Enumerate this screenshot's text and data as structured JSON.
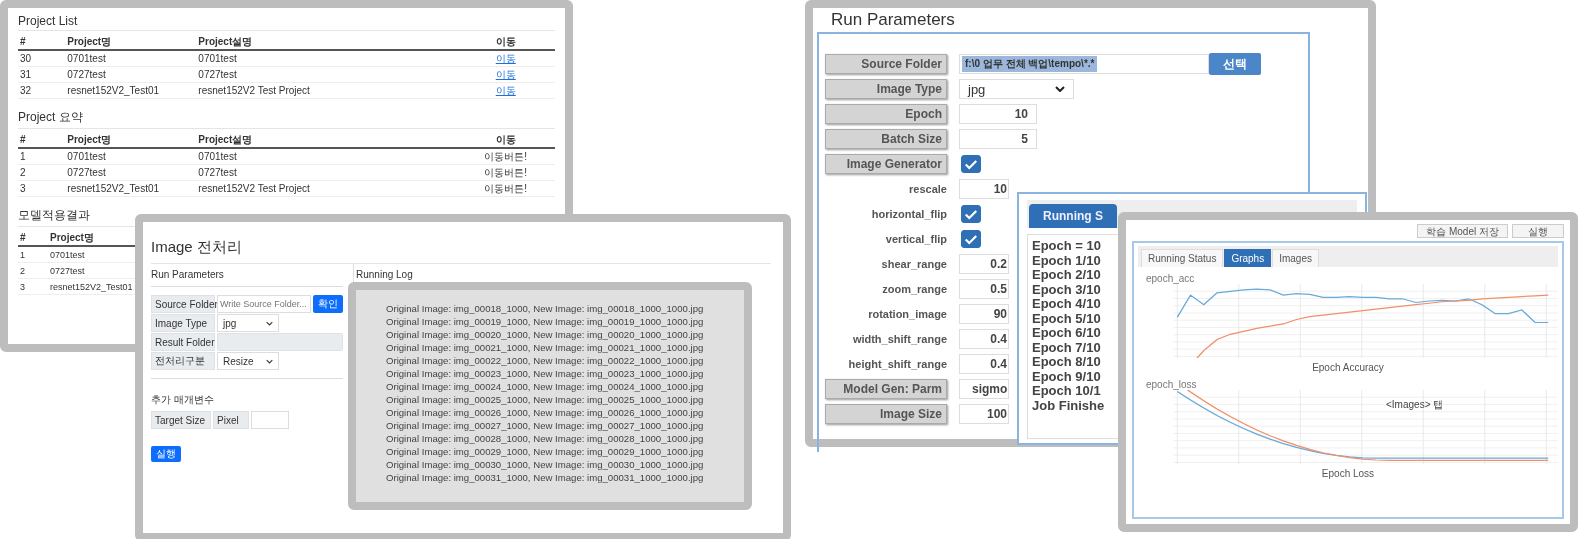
{
  "project_window": {
    "sections": [
      {
        "title": "Project List",
        "columns": [
          "#",
          "Project명",
          "Project설명",
          "이동"
        ],
        "kind": "link",
        "rows": [
          {
            "cells": [
              "30",
              "0701test",
              "0701test"
            ],
            "action": "이동"
          },
          {
            "cells": [
              "31",
              "0727test",
              "0727test"
            ],
            "action": "이동"
          },
          {
            "cells": [
              "32",
              "resnet152V2_Test01",
              "resnet152V2 Test Project"
            ],
            "action": "이동"
          }
        ]
      },
      {
        "title": "Project 요약",
        "columns": [
          "#",
          "Project명",
          "Project설명",
          "이동"
        ],
        "kind": "text",
        "rows": [
          {
            "cells": [
              "1",
              "0701test",
              "0701test"
            ],
            "action": "이동버튼!"
          },
          {
            "cells": [
              "2",
              "0727test",
              "0727test"
            ],
            "action": "이동버튼!"
          },
          {
            "cells": [
              "3",
              "resnet152V2_Test01",
              "resnet152V2 Test Project"
            ],
            "action": "이동버튼!"
          }
        ]
      },
      {
        "title": "모델적용결과",
        "columns": [
          "#",
          "Project명"
        ],
        "rows": [
          {
            "cells": [
              "1",
              "0701test"
            ]
          },
          {
            "cells": [
              "2",
              "0727test"
            ]
          },
          {
            "cells": [
              "3",
              "resnet152V2_Test01"
            ]
          }
        ]
      }
    ]
  },
  "preprocess_window": {
    "title": "Image 전처리",
    "left_heading": "Run Parameters",
    "right_heading": "Running Log",
    "fields": [
      {
        "label": "Source Folder",
        "kind": "text",
        "placeholder": "Write Source Folder...",
        "button": "확인"
      },
      {
        "label": "Image Type",
        "kind": "select",
        "value": "jpg"
      },
      {
        "label": "Result Folder",
        "kind": "disabled"
      },
      {
        "label": "전처리구분",
        "kind": "select",
        "value": "Resize"
      }
    ],
    "extra_heading": "추가 매개변수",
    "extra": {
      "label": "Target Size",
      "unit": "Pixel"
    },
    "run_button": "실행"
  },
  "log_window": {
    "lines": [
      "Original Image: img_00018_1000, New Image: img_00018_1000_1000.jpg",
      "Original Image: img_00019_1000, New Image: img_00019_1000_1000.jpg",
      "Original Image: img_00020_1000, New Image: img_00020_1000_1000.jpg",
      "Original Image: img_00021_1000, New Image: img_00021_1000_1000.jpg",
      "Original Image: img_00022_1000, New Image: img_00022_1000_1000.jpg",
      "Original Image: img_00023_1000, New Image: img_00023_1000_1000.jpg",
      "Original Image: img_00024_1000, New Image: img_00024_1000_1000.jpg",
      "Original Image: img_00025_1000, New Image: img_00025_1000_1000.jpg",
      "Original Image: img_00026_1000, New Image: img_00026_1000_1000.jpg",
      "Original Image: img_00027_1000, New Image: img_00027_1000_1000.jpg",
      "Original Image: img_00028_1000, New Image: img_00028_1000_1000.jpg",
      "Original Image: img_00029_1000, New Image: img_00029_1000_1000.jpg",
      "Original Image: img_00030_1000, New Image: img_00030_1000_1000.jpg",
      "Original Image: img_00031_1000, New Image: img_00031_1000_1000.jpg"
    ]
  },
  "training_window": {
    "title": "Run Parameters",
    "parameters": [
      {
        "label": {
          "text": "Source Folder",
          "kind": "button"
        },
        "kind": "folder",
        "value": "f:\\0 업무 전체 백업\\tempo\\*.*",
        "button": "선택"
      },
      {
        "label": {
          "text": "Image Type",
          "kind": "button"
        },
        "kind": "select",
        "value": "jpg"
      },
      {
        "label": {
          "text": "Epoch",
          "kind": "button"
        },
        "kind": "number",
        "value": "10"
      },
      {
        "label": {
          "text": "Batch Size",
          "kind": "button"
        },
        "kind": "number",
        "value": "5"
      },
      {
        "label": {
          "text": "Image Generator",
          "kind": "button"
        },
        "kind": "check",
        "checked": true
      }
    ],
    "more_parameters": [
      {
        "label": {
          "text": "rescale",
          "kind": "plain"
        },
        "kind": "number",
        "value": "10"
      },
      {
        "label": {
          "text": "horizontal_flip",
          "kind": "plain"
        },
        "kind": "check",
        "checked": true
      },
      {
        "label": {
          "text": "vertical_flip",
          "kind": "plain"
        },
        "kind": "check",
        "checked": true
      },
      {
        "label": {
          "text": "shear_range",
          "kind": "plain"
        },
        "kind": "number",
        "value": "0.2"
      },
      {
        "label": {
          "text": "zoom_range",
          "kind": "plain"
        },
        "kind": "number",
        "value": "0.5"
      },
      {
        "label": {
          "text": "rotation_image",
          "kind": "plain"
        },
        "kind": "number",
        "value": "90"
      },
      {
        "label": {
          "text": "width_shift_range",
          "kind": "plain"
        },
        "kind": "number",
        "value": "0.4"
      },
      {
        "label": {
          "text": "height_shift_range",
          "kind": "plain"
        },
        "kind": "number",
        "value": "0.4"
      },
      {
        "label": {
          "text": "Model Gen: Parm",
          "kind": "button"
        },
        "kind": "text",
        "value": "sigmo"
      },
      {
        "label": {
          "text": "Image Size",
          "kind": "button"
        },
        "kind": "number",
        "value": "100"
      }
    ]
  },
  "status_window": {
    "tabs": [
      {
        "label": "Running S",
        "selected": true
      }
    ],
    "log": [
      "Epoch = 10",
      "Epoch 1/10",
      "Epoch 2/10",
      "Epoch 3/10",
      "Epoch 4/10",
      "Epoch 5/10",
      "Epoch 6/10",
      "Epoch 7/10",
      "Epoch 8/10",
      "Epoch 9/10",
      "Epoch 10/1",
      "Job Finishe"
    ]
  },
  "graph_window": {
    "buttons": [
      "학습 Model 저장",
      "실행"
    ],
    "tabs": [
      {
        "label": "Running Status",
        "selected": false
      },
      {
        "label": "Graphs",
        "selected": true
      },
      {
        "label": "Images",
        "selected": false
      }
    ],
    "charts": [
      {
        "kind": "accuracy",
        "axis_label": "epoch_acc",
        "caption": "Epoch Accuracy"
      },
      {
        "kind": "loss",
        "axis_label": "epoch_loss",
        "caption": "Epoch Loss",
        "overlay": "<Images> 탭"
      }
    ]
  }
}
